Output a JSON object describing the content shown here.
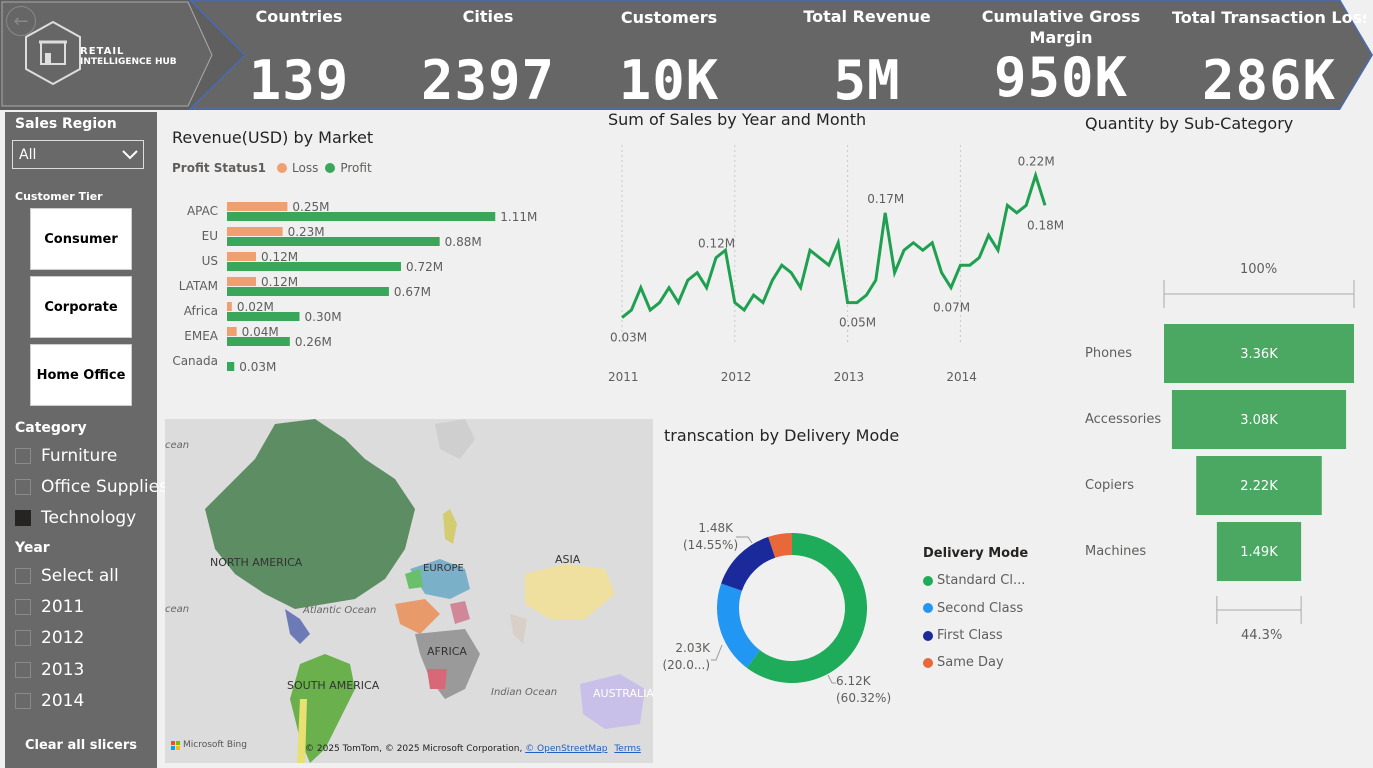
{
  "header": {
    "logo_line1": "RETAIL",
    "logo_line2": "INTELLIGENCE HUB",
    "kpis": [
      {
        "title": "Countries",
        "value": "139"
      },
      {
        "title": "Cities",
        "value": "2397"
      },
      {
        "title": "Customers",
        "value": "10K"
      },
      {
        "title": "Total Revenue",
        "value": "5M"
      },
      {
        "title": "Cumulative Gross Margin",
        "value": "950K"
      },
      {
        "title": "Total Transaction Loss",
        "value": "286K"
      }
    ]
  },
  "sidebar": {
    "region_label": "Sales Region",
    "region_selected": "All",
    "tier_label": "Customer Tier",
    "tiers": [
      "Consumer",
      "Corporate",
      "Home Office"
    ],
    "category_label": "Category",
    "categories": [
      {
        "label": "Furniture",
        "checked": false
      },
      {
        "label": "Office Supplies",
        "checked": false
      },
      {
        "label": "Technology",
        "checked": true
      }
    ],
    "year_label": "Year",
    "years": [
      {
        "label": "Select all",
        "checked": false
      },
      {
        "label": "2011",
        "checked": false
      },
      {
        "label": "2012",
        "checked": false
      },
      {
        "label": "2013",
        "checked": false
      },
      {
        "label": "2014",
        "checked": false
      }
    ],
    "clear_label": "Clear all slicers"
  },
  "market_chart": {
    "title": "Revenue(USD) by Market",
    "legend_title": "Profit Status1",
    "legend": [
      {
        "name": "Loss",
        "color": "#f0a070"
      },
      {
        "name": "Profit",
        "color": "#3aa65a"
      }
    ]
  },
  "sales_chart": {
    "title": "Sum of Sales by Year and Month"
  },
  "map": {
    "labels": {
      "north_america": "NORTH AMERICA",
      "south_america": "SOUTH AMERICA",
      "europe": "EUROPE",
      "asia": "ASIA",
      "africa": "AFRICA",
      "australia": "AUSTRALIA",
      "atlantic": "Atlantic Ocean",
      "indian": "Indian Ocean",
      "ocean_left_top": "cean",
      "ocean_left_mid": "cean"
    },
    "bing": "Microsoft Bing",
    "copyright": "© 2025 TomTom, © 2025 Microsoft Corporation,",
    "osm": "© OpenStreetMap",
    "terms": "Terms"
  },
  "delivery_chart": {
    "title": "transcation by Delivery Mode",
    "legend_title": "Delivery Mode",
    "legend": [
      "Standard Cl...",
      "Second Class",
      "First Class",
      "Same Day"
    ],
    "labels": {
      "standard_value": "6.12K",
      "standard_pct": "(60.32%)",
      "second_value": "2.03K",
      "second_pct": "(20.0...)",
      "first_value": "1.48K",
      "first_pct": "(14.55%)"
    }
  },
  "funnel": {
    "title": "Quantity by Sub-Category",
    "top_pct": "100%",
    "bottom_pct": "44.3%"
  },
  "chart_data": [
    {
      "type": "bar",
      "title": "Revenue(USD) by Market",
      "categories": [
        "APAC",
        "EU",
        "US",
        "LATAM",
        "Africa",
        "EMEA",
        "Canada"
      ],
      "series": [
        {
          "name": "Loss",
          "color": "#f0a070",
          "values": [
            0.25,
            0.23,
            0.12,
            0.12,
            0.02,
            0.04,
            0
          ],
          "labels": [
            "0.25M",
            "0.23M",
            "0.12M",
            "0.12M",
            "0.02M",
            "0.04M",
            ""
          ]
        },
        {
          "name": "Profit",
          "color": "#3aa65a",
          "values": [
            1.11,
            0.88,
            0.72,
            0.67,
            0.3,
            0.26,
            0.03
          ],
          "labels": [
            "1.11M",
            "0.88M",
            "0.72M",
            "0.67M",
            "0.30M",
            "0.26M",
            "0.03M"
          ]
        }
      ],
      "xlim": [
        0,
        1.2
      ]
    },
    {
      "type": "line",
      "title": "Sum of Sales by Year and Month",
      "x_ticks": [
        "2011",
        "2012",
        "2013",
        "2014"
      ],
      "color": "#1ea050",
      "values": [
        0.03,
        0.04,
        0.07,
        0.04,
        0.05,
        0.07,
        0.05,
        0.08,
        0.09,
        0.07,
        0.11,
        0.12,
        0.05,
        0.04,
        0.06,
        0.05,
        0.08,
        0.1,
        0.09,
        0.07,
        0.12,
        0.11,
        0.1,
        0.13,
        0.05,
        0.05,
        0.06,
        0.08,
        0.17,
        0.09,
        0.12,
        0.13,
        0.12,
        0.13,
        0.09,
        0.07,
        0.1,
        0.1,
        0.11,
        0.14,
        0.12,
        0.18,
        0.17,
        0.18,
        0.22,
        0.18
      ],
      "data_labels": [
        {
          "index": 0,
          "text": "0.03M"
        },
        {
          "index": 10,
          "text": "0.12M"
        },
        {
          "index": 25,
          "text": "0.05M"
        },
        {
          "index": 28,
          "text": "0.17M"
        },
        {
          "index": 35,
          "text": "0.07M"
        },
        {
          "index": 44,
          "text": "0.22M"
        },
        {
          "index": 45,
          "text": "0.18M"
        }
      ],
      "ylim": [
        0,
        0.25
      ]
    },
    {
      "type": "pie",
      "title": "transcation by Delivery Mode",
      "slices": [
        {
          "name": "Standard Class",
          "value": 6.12,
          "pct": 60.32,
          "color": "#1eab5a"
        },
        {
          "name": "Second Class",
          "value": 2.03,
          "pct": 20.0,
          "color": "#2196f3"
        },
        {
          "name": "First Class",
          "value": 1.48,
          "pct": 14.55,
          "color": "#1a2a9a"
        },
        {
          "name": "Same Day",
          "value": 0.52,
          "pct": 5.13,
          "color": "#e8683a"
        }
      ]
    },
    {
      "type": "bar",
      "title": "Quantity by Sub-Category",
      "categories": [
        "Phones",
        "Accessories",
        "Copiers",
        "Machines"
      ],
      "values": [
        3.36,
        3.08,
        2.22,
        1.49
      ],
      "labels": [
        "3.36K",
        "3.08K",
        "2.22K",
        "1.49K"
      ],
      "color": "#4aa862"
    }
  ]
}
